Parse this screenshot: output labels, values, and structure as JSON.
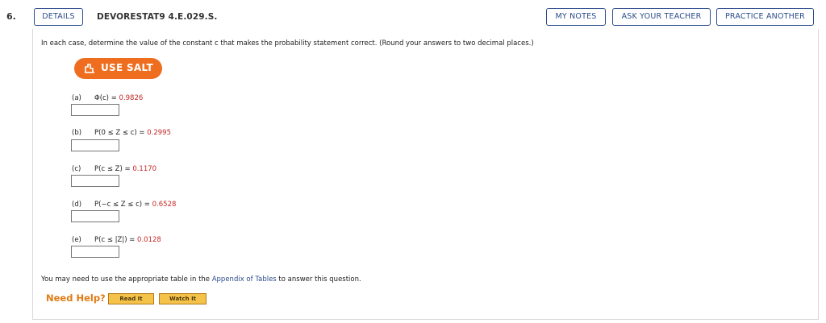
{
  "question": {
    "number": "6.",
    "details_label": "DETAILS",
    "code": "DEVORESTAT9 4.E.029.S."
  },
  "toolbar": {
    "my_notes": "MY NOTES",
    "ask_teacher": "ASK YOUR TEACHER",
    "practice_another": "PRACTICE ANOTHER"
  },
  "instructions": "In each case, determine the value of the constant c that makes the probability statement correct. (Round your answers to two decimal places.)",
  "salt": {
    "label": "USE SALT",
    "icon": "salt-chart-icon",
    "color": "#ee6d1e"
  },
  "parts": [
    {
      "label": "(a)",
      "expr": "Φ(c) = ",
      "value": "0.9826",
      "answer": ""
    },
    {
      "label": "(b)",
      "expr": "P(0 ≤ Z ≤ c) = ",
      "value": "0.2995",
      "answer": ""
    },
    {
      "label": "(c)",
      "expr": "P(c ≤ Z) = ",
      "value": "0.1170",
      "answer": ""
    },
    {
      "label": "(d)",
      "expr": "P(−c ≤ Z ≤ c) = ",
      "value": "0.6528",
      "answer": ""
    },
    {
      "label": "(e)",
      "expr": "P(c ≤ |Z|) = ",
      "value": "0.0128",
      "answer": ""
    }
  ],
  "table_note": {
    "before": "You may need to use the appropriate table in the ",
    "link": "Appendix of Tables",
    "after": " to answer this question."
  },
  "help": {
    "label": "Need Help?",
    "read_it": "Read It",
    "watch_it": "Watch It"
  },
  "colors": {
    "accent": "#2c4d8c",
    "value_red": "#c62828",
    "help_orange": "#e07b14"
  }
}
